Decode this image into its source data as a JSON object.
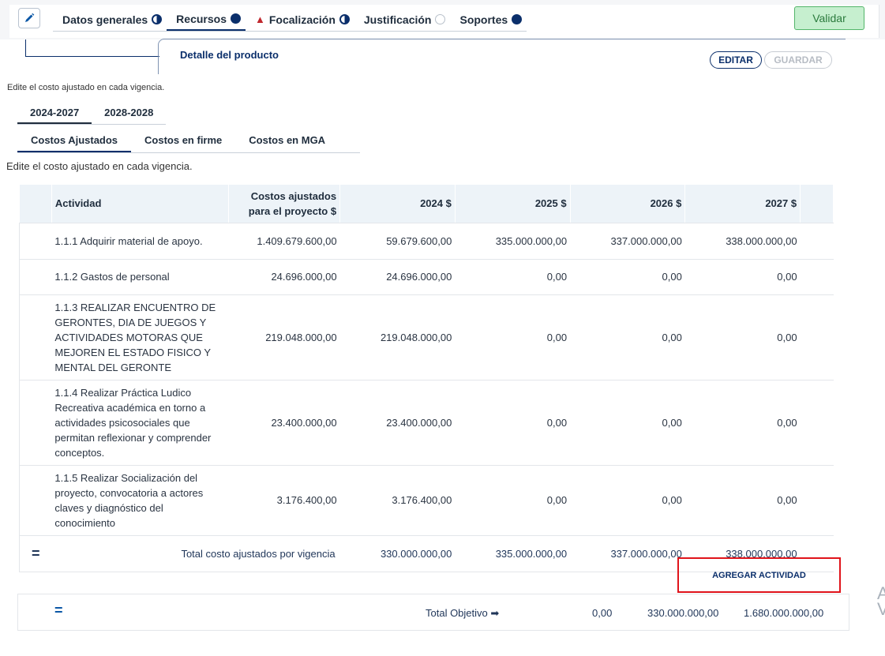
{
  "toolbar": {
    "nav_tabs": [
      {
        "label": "Datos generales",
        "status": "half"
      },
      {
        "label": "Recursos",
        "status": "full"
      },
      {
        "label": "Focalización",
        "status": "half",
        "warning": true
      },
      {
        "label": "Justificación",
        "status": "empty"
      },
      {
        "label": "Soportes",
        "status": "full"
      }
    ],
    "validate_label": "Validar"
  },
  "detail": {
    "title": "Detalle del producto",
    "edit_label": "EDITAR",
    "save_label": "GUARDAR",
    "hint": "Edite el costo ajustado en cada vigencia."
  },
  "period_tabs": [
    "2024-2027",
    "2028-2028"
  ],
  "cost_tabs": [
    "Costos Ajustados",
    "Costos en firme",
    "Costos en MGA"
  ],
  "cost_hint": "Edite el costo ajustado en cada vigencia.",
  "table": {
    "headers": [
      "Actividad",
      "Costos ajustados para el proyecto $",
      "2024 $",
      "2025 $",
      "2026 $",
      "2027 $"
    ],
    "rows": [
      {
        "activity": "1.1.1 Adquirir material de apoyo.",
        "total": "1.409.679.600,00",
        "y2024": "59.679.600,00",
        "y2025": "335.000.000,00",
        "y2026": "337.000.000,00",
        "y2027": "338.000.000,00"
      },
      {
        "activity": "1.1.2 Gastos de personal",
        "total": "24.696.000,00",
        "y2024": "24.696.000,00",
        "y2025": "0,00",
        "y2026": "0,00",
        "y2027": "0,00"
      },
      {
        "activity": "1.1.3 REALIZAR ENCUENTRO DE GERONTES, DIA DE JUEGOS Y ACTIVIDADES MOTORAS QUE MEJOREN EL ESTADO FISICO Y MENTAL DEL GERONTE",
        "total": "219.048.000,00",
        "y2024": "219.048.000,00",
        "y2025": "0,00",
        "y2026": "0,00",
        "y2027": "0,00"
      },
      {
        "activity": "1.1.4 Realizar Práctica Ludico Recreativa académica en torno a actividades psicosociales que permitan reflexionar y comprender conceptos.",
        "total": "23.400.000,00",
        "y2024": "23.400.000,00",
        "y2025": "0,00",
        "y2026": "0,00",
        "y2027": "0,00"
      },
      {
        "activity": "1.1.5 Realizar Socialización del proyecto, convocatoria a actores claves y diagnóstico del conocimiento",
        "total": "3.176.400,00",
        "y2024": "3.176.400,00",
        "y2025": "0,00",
        "y2026": "0,00",
        "y2027": "0,00"
      }
    ],
    "total_row": {
      "sign": "=",
      "label": "Total costo ajustados por vigencia",
      "y2024": "330.000.000,00",
      "y2025": "335.000.000,00",
      "y2026": "337.000.000,00",
      "y2027": "338.000.000,00"
    }
  },
  "add_activity_label": "AGREGAR ACTIVIDAD",
  "objective": {
    "sign": "=",
    "label": "Total Objetivo ➡",
    "v1": "0,00",
    "v2": "330.000.000,00",
    "v3": "1.680.000.000,00"
  },
  "colors": {
    "primary": "#0b2f6b",
    "validate_bg": "#c6efcf",
    "highlight": "#e0141b",
    "header_bg": "#edf3f8"
  }
}
